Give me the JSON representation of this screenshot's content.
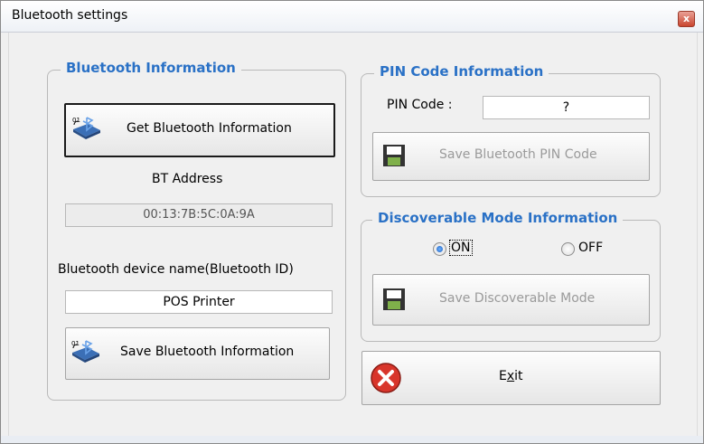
{
  "window": {
    "title": "Bluetooth settings",
    "close_glyph": "x"
  },
  "bt_info": {
    "legend": "Bluetooth Information",
    "get_button": "Get Bluetooth Information",
    "address_label": "BT Address",
    "address_value": "00:13:7B:5C:0A:9A",
    "name_label": "Bluetooth device name(Bluetooth ID)",
    "name_value": "POS Printer",
    "save_button": "Save Bluetooth Information",
    "icon_badge": "01"
  },
  "pin": {
    "legend": "PIN Code Information",
    "label": "PIN Code :",
    "value": "?",
    "save_button": "Save Bluetooth PIN Code"
  },
  "discoverable": {
    "legend": "Discoverable Mode Information",
    "on_label": "ON",
    "off_label": "OFF",
    "selected": "ON",
    "save_button": "Save Discoverable Mode"
  },
  "exit": {
    "label_pre": "E",
    "label_underlined": "x",
    "label_post": "it"
  },
  "colors": {
    "legend": "#2a71c6",
    "exit_icon": "#d8352b",
    "disabled_text": "#9a9a9a"
  }
}
